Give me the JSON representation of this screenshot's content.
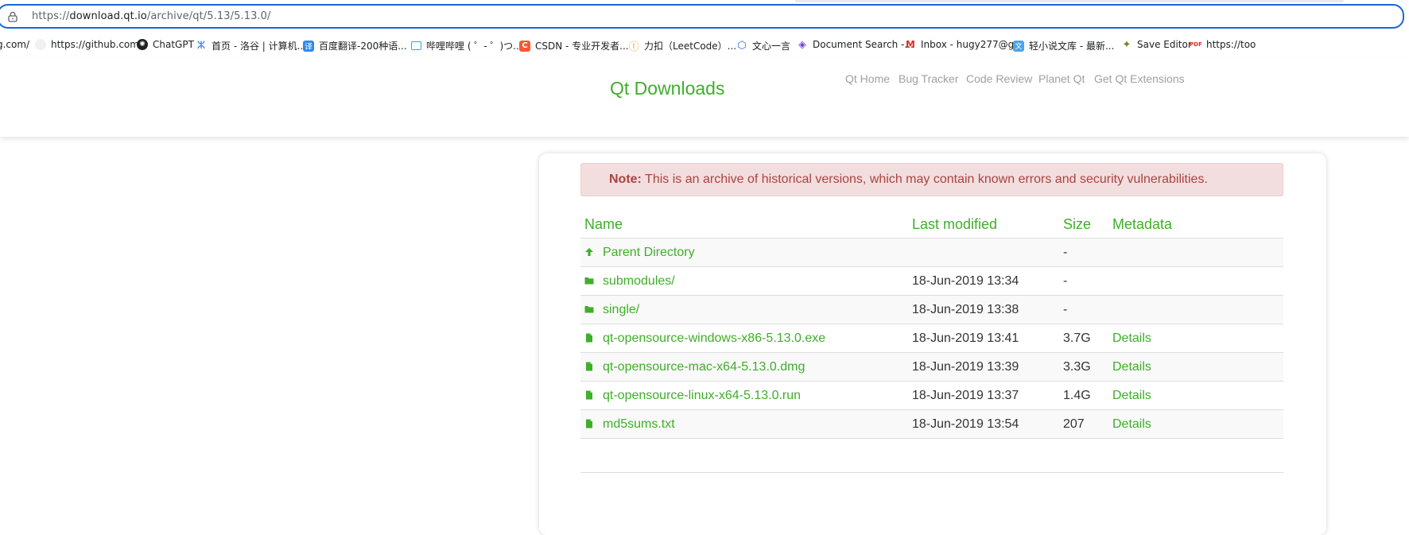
{
  "browser": {
    "url_prefix": "https://",
    "url_host": "download.qt.io",
    "url_path": "/archive/qt/5.13/5.13.0/"
  },
  "bookmarks": [
    {
      "label": "g.com/",
      "icon": "none"
    },
    {
      "label": "https://github.com/",
      "icon": "github-icon"
    },
    {
      "label": "ChatGPT",
      "icon": "chatgpt-icon"
    },
    {
      "label": "首页 - 洛谷 | 计算机...",
      "icon": "luogu-icon"
    },
    {
      "label": "百度翻译-200种语...",
      "icon": "baidu-translate-icon"
    },
    {
      "label": "哔哩哔哩 ( ゜- ゜)つ...",
      "icon": "bilibili-icon"
    },
    {
      "label": "CSDN - 专业开发者...",
      "icon": "csdn-icon"
    },
    {
      "label": "力扣（LeetCode）...",
      "icon": "leetcode-icon"
    },
    {
      "label": "文心一言",
      "icon": "wenxin-icon"
    },
    {
      "label": "Document Search -...",
      "icon": "docsearch-icon"
    },
    {
      "label": "Inbox - hugy277@g...",
      "icon": "gmail-icon"
    },
    {
      "label": "轻小说文库 - 最新...",
      "icon": "wenku-icon"
    },
    {
      "label": "Save Editor",
      "icon": "save-editor-icon"
    },
    {
      "label": "https://too",
      "icon": "pdf24-icon"
    }
  ],
  "header": {
    "title": "Qt Downloads",
    "nav": [
      "Qt Home",
      "Bug Tracker",
      "Code Review",
      "Planet Qt",
      "Get Qt Extensions"
    ]
  },
  "note": {
    "label": "Note:",
    "text": "This is an archive of historical versions, which may contain known errors and security vulnerabilities."
  },
  "table": {
    "headers": [
      "Name",
      "Last modified",
      "Size",
      "Metadata"
    ],
    "rows": [
      {
        "icon": "arrow-up-icon",
        "name": "Parent Directory",
        "modified": "",
        "size": "-",
        "meta": ""
      },
      {
        "icon": "folder-icon",
        "name": "submodules/",
        "modified": "18-Jun-2019 13:34",
        "size": "-",
        "meta": ""
      },
      {
        "icon": "folder-icon",
        "name": "single/",
        "modified": "18-Jun-2019 13:38",
        "size": "-",
        "meta": ""
      },
      {
        "icon": "file-icon",
        "name": "qt-opensource-windows-x86-5.13.0.exe",
        "modified": "18-Jun-2019 13:41",
        "size": "3.7G",
        "meta": "Details"
      },
      {
        "icon": "file-icon",
        "name": "qt-opensource-mac-x64-5.13.0.dmg",
        "modified": "18-Jun-2019 13:39",
        "size": "3.3G",
        "meta": "Details"
      },
      {
        "icon": "file-icon",
        "name": "qt-opensource-linux-x64-5.13.0.run",
        "modified": "18-Jun-2019 13:37",
        "size": "1.4G",
        "meta": "Details"
      },
      {
        "icon": "file-icon",
        "name": "md5sums.txt",
        "modified": "18-Jun-2019 13:54",
        "size": "207",
        "meta": "Details"
      }
    ]
  },
  "colors": {
    "accent": "#3fae2a",
    "note_bg": "#f2dede",
    "note_text": "#a94442",
    "focus_ring": "#1a66d6"
  }
}
